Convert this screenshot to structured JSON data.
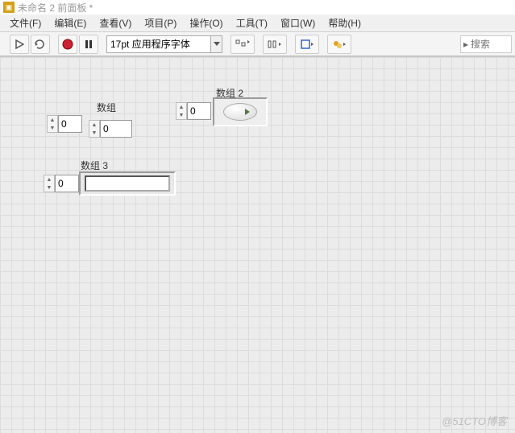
{
  "title": "未命名 2 前面板 *",
  "menu": {
    "file": "文件(F)",
    "edit": "编辑(E)",
    "view": "查看(V)",
    "project": "项目(P)",
    "operate": "操作(O)",
    "tools": "工具(T)",
    "window": "窗口(W)",
    "help": "帮助(H)"
  },
  "toolbar": {
    "font": "17pt 应用程序字体"
  },
  "search": {
    "placeholder": "搜索"
  },
  "controls": {
    "array1": {
      "label": "数组",
      "index": "0",
      "value": "0"
    },
    "array2": {
      "label": "数组 2",
      "index": "0"
    },
    "array3": {
      "label": "数组 3",
      "index": "0"
    }
  },
  "watermark": "@51CTO博客"
}
